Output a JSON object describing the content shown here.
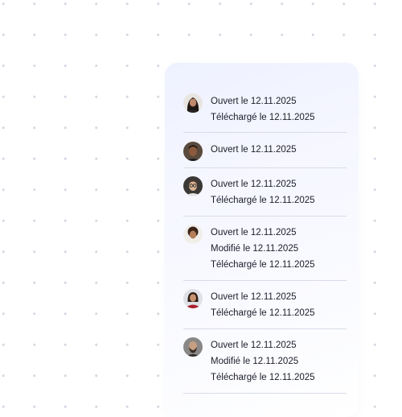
{
  "activity": [
    {
      "avatar": "woman-dark-hair-avatar",
      "lines": [
        "Ouvert le 12.11.2025",
        "Téléchargé le 12.11.2025"
      ]
    },
    {
      "avatar": "man-short-hair-avatar",
      "lines": [
        "Ouvert le 12.11.2025"
      ]
    },
    {
      "avatar": "man-glasses-avatar",
      "lines": [
        "Ouvert le 12.11.2025",
        "Téléchargé le 12.11.2025"
      ]
    },
    {
      "avatar": "woman-curly-hair-avatar",
      "lines": [
        "Ouvert le 12.11.2025",
        "Modifié le 12.11.2025",
        "Téléchargé le 12.11.2025"
      ]
    },
    {
      "avatar": "woman-red-top-avatar",
      "lines": [
        "Ouvert le 12.11.2025",
        "Téléchargé le 12.11.2025"
      ]
    },
    {
      "avatar": "man-beard-avatar",
      "lines": [
        "Ouvert le 12.11.2025",
        "Modifié le 12.11.2025",
        "Téléchargé le 12.11.2025"
      ]
    }
  ]
}
